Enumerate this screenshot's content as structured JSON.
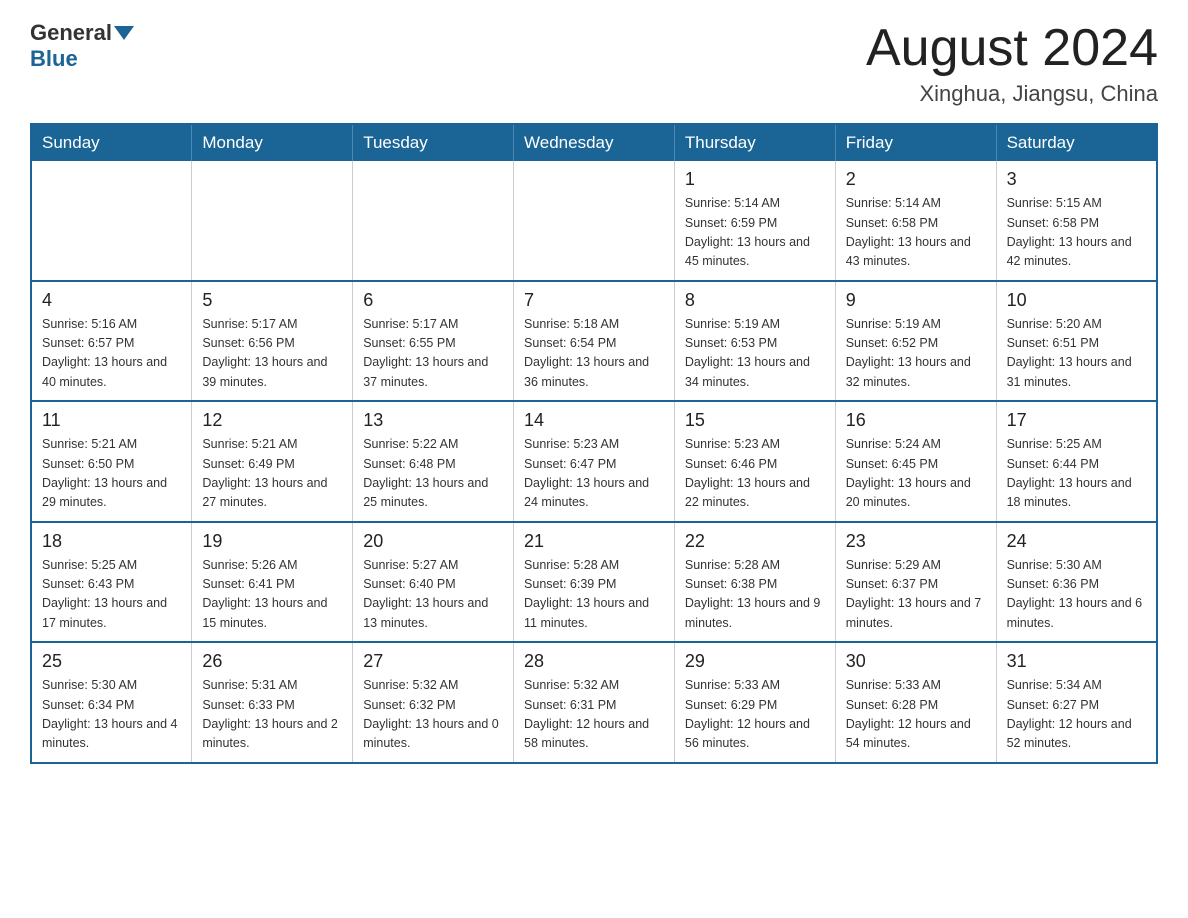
{
  "logo": {
    "general": "General",
    "blue": "Blue"
  },
  "title": "August 2024",
  "location": "Xinghua, Jiangsu, China",
  "days_of_week": [
    "Sunday",
    "Monday",
    "Tuesday",
    "Wednesday",
    "Thursday",
    "Friday",
    "Saturday"
  ],
  "weeks": [
    [
      {
        "day": "",
        "info": ""
      },
      {
        "day": "",
        "info": ""
      },
      {
        "day": "",
        "info": ""
      },
      {
        "day": "",
        "info": ""
      },
      {
        "day": "1",
        "info": "Sunrise: 5:14 AM\nSunset: 6:59 PM\nDaylight: 13 hours and 45 minutes."
      },
      {
        "day": "2",
        "info": "Sunrise: 5:14 AM\nSunset: 6:58 PM\nDaylight: 13 hours and 43 minutes."
      },
      {
        "day": "3",
        "info": "Sunrise: 5:15 AM\nSunset: 6:58 PM\nDaylight: 13 hours and 42 minutes."
      }
    ],
    [
      {
        "day": "4",
        "info": "Sunrise: 5:16 AM\nSunset: 6:57 PM\nDaylight: 13 hours and 40 minutes."
      },
      {
        "day": "5",
        "info": "Sunrise: 5:17 AM\nSunset: 6:56 PM\nDaylight: 13 hours and 39 minutes."
      },
      {
        "day": "6",
        "info": "Sunrise: 5:17 AM\nSunset: 6:55 PM\nDaylight: 13 hours and 37 minutes."
      },
      {
        "day": "7",
        "info": "Sunrise: 5:18 AM\nSunset: 6:54 PM\nDaylight: 13 hours and 36 minutes."
      },
      {
        "day": "8",
        "info": "Sunrise: 5:19 AM\nSunset: 6:53 PM\nDaylight: 13 hours and 34 minutes."
      },
      {
        "day": "9",
        "info": "Sunrise: 5:19 AM\nSunset: 6:52 PM\nDaylight: 13 hours and 32 minutes."
      },
      {
        "day": "10",
        "info": "Sunrise: 5:20 AM\nSunset: 6:51 PM\nDaylight: 13 hours and 31 minutes."
      }
    ],
    [
      {
        "day": "11",
        "info": "Sunrise: 5:21 AM\nSunset: 6:50 PM\nDaylight: 13 hours and 29 minutes."
      },
      {
        "day": "12",
        "info": "Sunrise: 5:21 AM\nSunset: 6:49 PM\nDaylight: 13 hours and 27 minutes."
      },
      {
        "day": "13",
        "info": "Sunrise: 5:22 AM\nSunset: 6:48 PM\nDaylight: 13 hours and 25 minutes."
      },
      {
        "day": "14",
        "info": "Sunrise: 5:23 AM\nSunset: 6:47 PM\nDaylight: 13 hours and 24 minutes."
      },
      {
        "day": "15",
        "info": "Sunrise: 5:23 AM\nSunset: 6:46 PM\nDaylight: 13 hours and 22 minutes."
      },
      {
        "day": "16",
        "info": "Sunrise: 5:24 AM\nSunset: 6:45 PM\nDaylight: 13 hours and 20 minutes."
      },
      {
        "day": "17",
        "info": "Sunrise: 5:25 AM\nSunset: 6:44 PM\nDaylight: 13 hours and 18 minutes."
      }
    ],
    [
      {
        "day": "18",
        "info": "Sunrise: 5:25 AM\nSunset: 6:43 PM\nDaylight: 13 hours and 17 minutes."
      },
      {
        "day": "19",
        "info": "Sunrise: 5:26 AM\nSunset: 6:41 PM\nDaylight: 13 hours and 15 minutes."
      },
      {
        "day": "20",
        "info": "Sunrise: 5:27 AM\nSunset: 6:40 PM\nDaylight: 13 hours and 13 minutes."
      },
      {
        "day": "21",
        "info": "Sunrise: 5:28 AM\nSunset: 6:39 PM\nDaylight: 13 hours and 11 minutes."
      },
      {
        "day": "22",
        "info": "Sunrise: 5:28 AM\nSunset: 6:38 PM\nDaylight: 13 hours and 9 minutes."
      },
      {
        "day": "23",
        "info": "Sunrise: 5:29 AM\nSunset: 6:37 PM\nDaylight: 13 hours and 7 minutes."
      },
      {
        "day": "24",
        "info": "Sunrise: 5:30 AM\nSunset: 6:36 PM\nDaylight: 13 hours and 6 minutes."
      }
    ],
    [
      {
        "day": "25",
        "info": "Sunrise: 5:30 AM\nSunset: 6:34 PM\nDaylight: 13 hours and 4 minutes."
      },
      {
        "day": "26",
        "info": "Sunrise: 5:31 AM\nSunset: 6:33 PM\nDaylight: 13 hours and 2 minutes."
      },
      {
        "day": "27",
        "info": "Sunrise: 5:32 AM\nSunset: 6:32 PM\nDaylight: 13 hours and 0 minutes."
      },
      {
        "day": "28",
        "info": "Sunrise: 5:32 AM\nSunset: 6:31 PM\nDaylight: 12 hours and 58 minutes."
      },
      {
        "day": "29",
        "info": "Sunrise: 5:33 AM\nSunset: 6:29 PM\nDaylight: 12 hours and 56 minutes."
      },
      {
        "day": "30",
        "info": "Sunrise: 5:33 AM\nSunset: 6:28 PM\nDaylight: 12 hours and 54 minutes."
      },
      {
        "day": "31",
        "info": "Sunrise: 5:34 AM\nSunset: 6:27 PM\nDaylight: 12 hours and 52 minutes."
      }
    ]
  ]
}
